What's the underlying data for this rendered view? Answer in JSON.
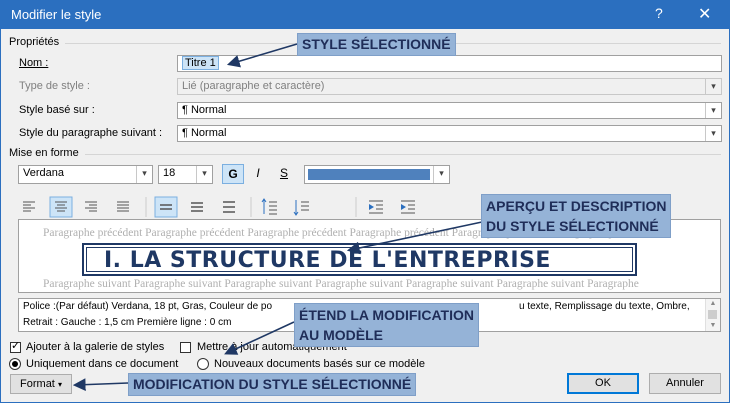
{
  "window": {
    "title": "Modifier le style",
    "help_glyph": "?",
    "close_glyph": "✕"
  },
  "properties": {
    "group_label": "Propriétés",
    "name_label": "Nom :",
    "name_value": "Titre 1",
    "type_label": "Type de style :",
    "type_value": "Lié (paragraphe et caractère)",
    "based_label": "Style basé sur :",
    "based_value": "¶  Normal",
    "next_label": "Style du paragraphe suivant :",
    "next_value": "¶  Normal"
  },
  "formatting": {
    "group_label": "Mise en forme",
    "font": "Verdana",
    "size": "18",
    "bold": "G",
    "italic": "I",
    "underline": "S",
    "font_color": "#4f81bd"
  },
  "preview": {
    "prev_text": "Paragraphe précédent Paragraphe précédent Paragraphe précédent Paragraphe précédent Paragraphe précédent Paragraphe précédent",
    "heading": "I.  LA STRUCTURE DE L'ENTREPRISE",
    "next_text": "Paragraphe suivant Paragraphe suivant Paragraphe suivant Paragraphe suivant Paragraphe suivant Paragraphe suivant Paragraphe"
  },
  "description": {
    "line1_start": "Police :(Par défaut) Verdana, 18 pt, Gras, Couleur de po",
    "line1_end": "u texte, Remplissage du texte, Ombre,",
    "line2_start": "Retrait : Gauche :  1,5 cm  Première ligne : 0 cm"
  },
  "options": {
    "add_gallery": "Ajouter à la galerie de styles",
    "auto_update": "Mettre à jour automatiquement",
    "only_doc": "Uniquement dans ce document",
    "new_docs": "Nouveaux documents basés sur ce modèle"
  },
  "buttons": {
    "format": "Format",
    "ok": "OK",
    "cancel": "Annuler"
  },
  "callouts": {
    "style_selected": "STYLE SÉLECTIONNÉ",
    "preview_line1": "APERÇU ET DESCRIPTION",
    "preview_line2": "DU STYLE SÉLECTIONNÉ",
    "extend_line1": "ÉTEND LA MODIFICATION",
    "extend_line2": "AU MODÈLE",
    "modify": "MODIFICATION DU STYLE SÉLECTIONNÉ"
  },
  "colors": {
    "title_bar": "#2b6fbf",
    "callout_bg": "#95b3d7",
    "heading_color": "#1f3864"
  },
  "icons": [
    "align-left-icon",
    "align-center-icon",
    "align-right-icon",
    "justify-icon",
    "line-spacing-single-icon",
    "line-spacing-1-5-icon",
    "line-spacing-double-icon",
    "increase-spacing-icon",
    "decrease-spacing-icon",
    "decrease-indent-icon",
    "increase-indent-icon",
    "dropdown-arrow-icon"
  ]
}
